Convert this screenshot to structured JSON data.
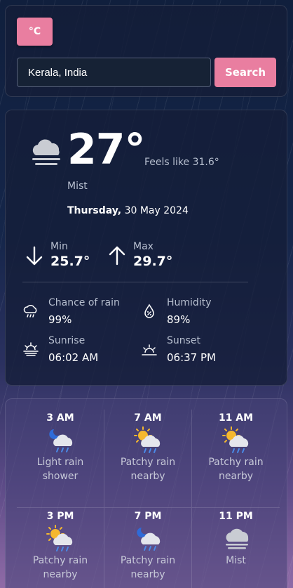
{
  "controls": {
    "unit_label": "°C",
    "search_value": "Kerala, India",
    "search_button": "Search"
  },
  "current": {
    "temperature": "27°",
    "feels_like": "Feels like 31.6°",
    "condition": "Mist",
    "day": "Thursday,",
    "date": " 30 May 2024",
    "icon": "mist-icon",
    "min_label": "Min",
    "min_value": "25.7°",
    "max_label": "Max",
    "max_value": "29.7°"
  },
  "stats": [
    {
      "label": "Chance of rain",
      "value": "99%",
      "icon": "rain-cloud-icon"
    },
    {
      "label": "Humidity",
      "value": "89%",
      "icon": "humidity-drop-icon"
    },
    {
      "label": "Sunrise",
      "value": "06:02 AM",
      "icon": "sunrise-icon"
    },
    {
      "label": "Sunset",
      "value": "06:37 PM",
      "icon": "sunset-icon"
    }
  ],
  "forecast": [
    {
      "time": "3 AM",
      "line1": "Light rain",
      "line2": "shower",
      "icon": "moon-cloud-rain-icon"
    },
    {
      "time": "7 AM",
      "line1": "Patchy rain",
      "line2": "nearby",
      "icon": "sun-cloud-rain-icon"
    },
    {
      "time": "11 AM",
      "line1": "Patchy rain",
      "line2": "nearby",
      "icon": "sun-cloud-rain-icon"
    },
    {
      "time": "3 PM",
      "line1": "Patchy rain",
      "line2": "nearby",
      "icon": "sun-cloud-rain-icon"
    },
    {
      "time": "7 PM",
      "line1": "Patchy rain",
      "line2": "nearby",
      "icon": "moon-cloud-rain-icon"
    },
    {
      "time": "11 PM",
      "line1": "Mist",
      "line2": "",
      "icon": "mist-icon"
    }
  ],
  "colors": {
    "accent": "#e97ea0",
    "card_bg": "#141e38",
    "muted_text": "#b7bfcf"
  }
}
